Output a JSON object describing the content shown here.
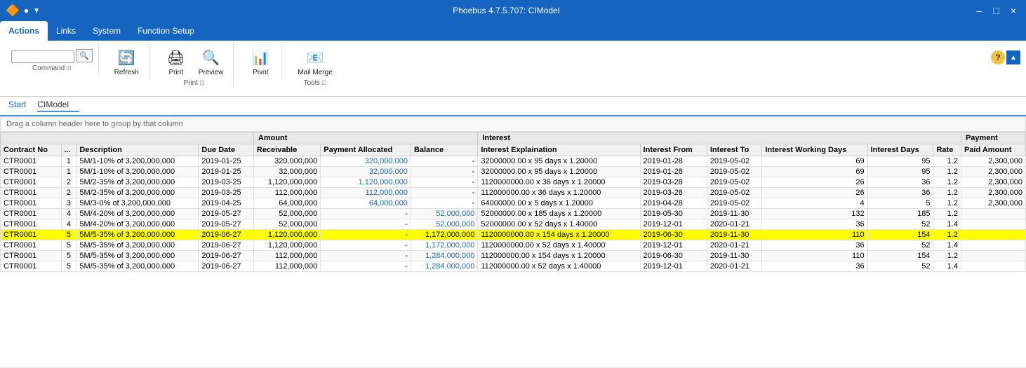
{
  "titleBar": {
    "title": "Phoebus 4.7.5.707: CIModel",
    "minimize": "–",
    "maximize": "□",
    "close": "×"
  },
  "ribbon": {
    "tabs": [
      {
        "label": "Actions",
        "active": true
      },
      {
        "label": "Links",
        "active": false
      },
      {
        "label": "System",
        "active": false
      },
      {
        "label": "Function Setup",
        "active": false
      }
    ],
    "groups": {
      "command": {
        "label": "Command",
        "searchPlaceholder": "",
        "searchBtn": "🔍"
      },
      "refresh": {
        "label": "Refresh",
        "icon": "🔄"
      },
      "print": {
        "label": "Print",
        "items": [
          {
            "label": "Print",
            "icon": "🖨"
          },
          {
            "label": "Preview",
            "icon": "🔍"
          }
        ],
        "groupLabel": "Print"
      },
      "pivot": {
        "label": "Pivot",
        "icon": "📊"
      },
      "mailMerge": {
        "label": "Mail Merge",
        "icon": "📧",
        "groupLabel": "Tools"
      }
    }
  },
  "breadcrumb": {
    "items": [
      "Start",
      "CIModel"
    ]
  },
  "groupHeader": "Drag a column header here to group by that column",
  "table": {
    "colGroups": [
      {
        "label": "",
        "colspan": 4
      },
      {
        "label": "Amount",
        "colspan": 3
      },
      {
        "label": "Interest",
        "colspan": 7
      },
      {
        "label": "Payment",
        "colspan": 2
      }
    ],
    "headers": [
      "Contract No",
      "...",
      "Description",
      "Due Date",
      "Receivable",
      "Payment Allocated",
      "Balance",
      "Interest Explaination",
      "Interest From",
      "Interest To",
      "Interest Working Days",
      "Interest Days",
      "Rate",
      "Paid Amount"
    ],
    "rows": [
      {
        "contract": "CTR0001",
        "seq": "1",
        "desc": "5M/1-10% of 3,200,000,000",
        "dueDate": "2019-01-25",
        "receivable": "320,000,000",
        "payAlloc": "320,000,000",
        "balance": "-",
        "intExpl": "32000000.00 x 95 days x 1.20000",
        "intFrom": "2019-01-28",
        "intTo": "2019-05-02",
        "intWorkDays": "69",
        "intDays": "95",
        "rate": "1.2",
        "paidAmt": "2,300,000",
        "highlight": false
      },
      {
        "contract": "CTR0001",
        "seq": "1",
        "desc": "5M/1-10% of 3,200,000,000",
        "dueDate": "2019-01-25",
        "receivable": "32,000,000",
        "payAlloc": "32,000,000",
        "balance": "-",
        "intExpl": "32000000.00 x 95 days x 1.20000",
        "intFrom": "2019-01-28",
        "intTo": "2019-05-02",
        "intWorkDays": "69",
        "intDays": "95",
        "rate": "1.2",
        "paidAmt": "2,300,000",
        "highlight": false
      },
      {
        "contract": "CTR0001",
        "seq": "2",
        "desc": "5M/2-35% of 3,200,000,000",
        "dueDate": "2019-03-25",
        "receivable": "1,120,000,000",
        "payAlloc": "1,120,000,000",
        "balance": "-",
        "intExpl": "1120000000.00 x 36 days x 1.20000",
        "intFrom": "2019-03-28",
        "intTo": "2019-05-02",
        "intWorkDays": "26",
        "intDays": "36",
        "rate": "1.2",
        "paidAmt": "2,300,000",
        "highlight": false
      },
      {
        "contract": "CTR0001",
        "seq": "2",
        "desc": "5M/2-35% of 3,200,000,000",
        "dueDate": "2019-03-25",
        "receivable": "112,000,000",
        "payAlloc": "112,000,000",
        "balance": "-",
        "intExpl": "112000000.00 x 36 days x 1.20000",
        "intFrom": "2019-03-28",
        "intTo": "2019-05-02",
        "intWorkDays": "26",
        "intDays": "36",
        "rate": "1.2",
        "paidAmt": "2,300,000",
        "highlight": false
      },
      {
        "contract": "CTR0001",
        "seq": "3",
        "desc": "5M/3-0% of 3,200,000,000",
        "dueDate": "2019-04-25",
        "receivable": "64,000,000",
        "payAlloc": "64,000,000",
        "balance": "-",
        "intExpl": "64000000.00 x 5 days x 1.20000",
        "intFrom": "2019-04-28",
        "intTo": "2019-05-02",
        "intWorkDays": "4",
        "intDays": "5",
        "rate": "1.2",
        "paidAmt": "2,300,000",
        "highlight": false
      },
      {
        "contract": "CTR0001",
        "seq": "4",
        "desc": "5M/4-20% of 3,200,000,000",
        "dueDate": "2019-05-27",
        "receivable": "52,000,000",
        "payAlloc": "-",
        "balance": "52,000,000",
        "intExpl": "52000000.00 x 185 days x 1.20000",
        "intFrom": "2019-05-30",
        "intTo": "2019-11-30",
        "intWorkDays": "132",
        "intDays": "185",
        "rate": "1.2",
        "paidAmt": "",
        "highlight": false
      },
      {
        "contract": "CTR0001",
        "seq": "4",
        "desc": "5M/4-20% of 3,200,000,000",
        "dueDate": "2019-05-27",
        "receivable": "52,000,000",
        "payAlloc": "-",
        "balance": "52,000,000",
        "intExpl": "52000000.00 x 52 days x 1.40000",
        "intFrom": "2019-12-01",
        "intTo": "2020-01-21",
        "intWorkDays": "36",
        "intDays": "52",
        "rate": "1.4",
        "paidAmt": "",
        "highlight": false
      },
      {
        "contract": "CTR0001",
        "seq": "5",
        "desc": "5M/5-35% of 3,200,000,000",
        "dueDate": "2019-06-27",
        "receivable": "1,120,000,000",
        "payAlloc": "-",
        "balance": "1,172,000,000",
        "intExpl": "1120000000.00 x 154 days x 1.20000",
        "intFrom": "2019-06-30",
        "intTo": "2019-11-30",
        "intWorkDays": "110",
        "intDays": "154",
        "rate": "1.2",
        "paidAmt": "",
        "highlight": true
      },
      {
        "contract": "CTR0001",
        "seq": "5",
        "desc": "5M/5-35% of 3,200,000,000",
        "dueDate": "2019-06-27",
        "receivable": "1,120,000,000",
        "payAlloc": "-",
        "balance": "1,172,000,000",
        "intExpl": "1120000000.00 x 52 days x 1.40000",
        "intFrom": "2019-12-01",
        "intTo": "2020-01-21",
        "intWorkDays": "36",
        "intDays": "52",
        "rate": "1.4",
        "paidAmt": "",
        "highlight": false
      },
      {
        "contract": "CTR0001",
        "seq": "5",
        "desc": "5M/5-35% of 3,200,000,000",
        "dueDate": "2019-06-27",
        "receivable": "112,000,000",
        "payAlloc": "-",
        "balance": "1,284,000,000",
        "intExpl": "112000000.00 x 154 days x 1.20000",
        "intFrom": "2019-06-30",
        "intTo": "2019-11-30",
        "intWorkDays": "110",
        "intDays": "154",
        "rate": "1.2",
        "paidAmt": "",
        "highlight": false
      },
      {
        "contract": "CTR0001",
        "seq": "5",
        "desc": "5M/5-35% of 3,200,000,000",
        "dueDate": "2019-06-27",
        "receivable": "112,000,000",
        "payAlloc": "-",
        "balance": "1,284,000,000",
        "intExpl": "112000000.00 x 52 days x 1.40000",
        "intFrom": "2019-12-01",
        "intTo": "2020-01-21",
        "intWorkDays": "36",
        "intDays": "52",
        "rate": "1.4",
        "paidAmt": "",
        "highlight": false
      }
    ]
  }
}
